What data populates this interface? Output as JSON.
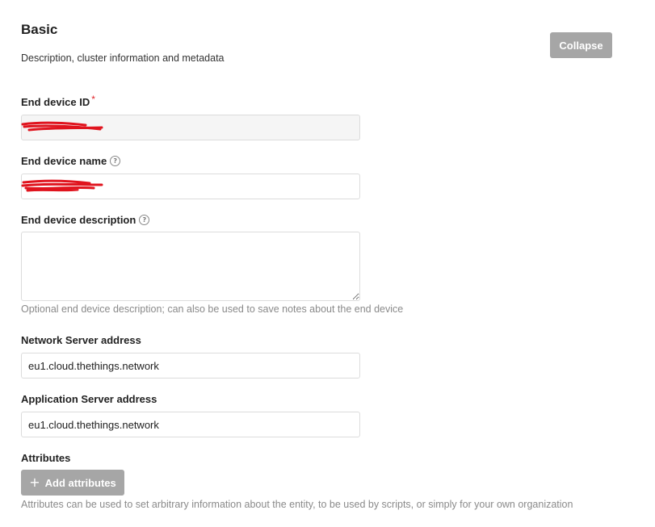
{
  "section": {
    "title": "Basic",
    "description": "Description, cluster information and metadata",
    "collapse_label": "Collapse"
  },
  "fields": {
    "end_device_id": {
      "label": "End device ID",
      "required_mark": "*",
      "value": ""
    },
    "end_device_name": {
      "label": "End device name",
      "value": ""
    },
    "end_device_description": {
      "label": "End device description",
      "value": "",
      "hint": "Optional end device description; can also be used to save notes about the end device"
    },
    "network_server_address": {
      "label": "Network Server address",
      "value": "eu1.cloud.thethings.network"
    },
    "application_server_address": {
      "label": "Application Server address",
      "value": "eu1.cloud.thethings.network"
    }
  },
  "attributes": {
    "label": "Attributes",
    "add_label": "Add attributes",
    "hint": "Attributes can be used to set arbitrary information about the entity, to be used by scripts, or simply for your own organization"
  },
  "icons": {
    "help": "help-circle-icon",
    "plus": "plus-icon"
  },
  "colors": {
    "button_bg": "#a6a6a6",
    "required": "#e0252a",
    "redaction": "#e0141e",
    "hint_text": "#8a8a8a"
  }
}
